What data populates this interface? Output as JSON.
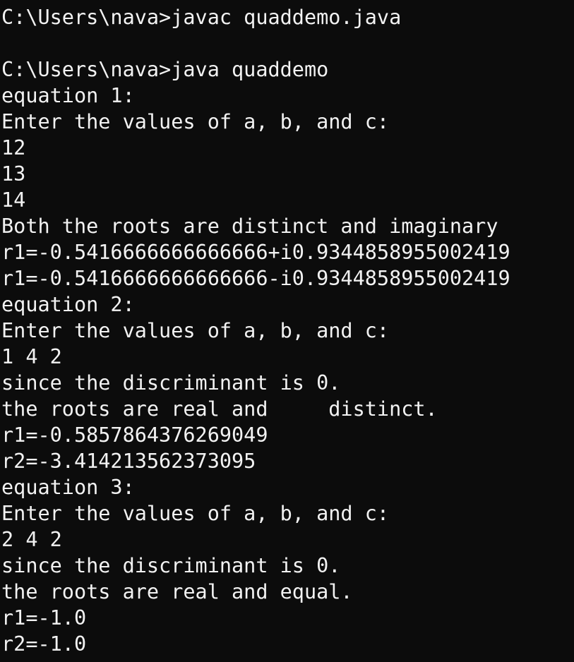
{
  "terminal": {
    "lines": [
      "C:\\Users\\nava>javac quaddemo.java",
      "",
      "C:\\Users\\nava>java quaddemo",
      "equation 1:",
      "Enter the values of a, b, and c:",
      "12",
      "13",
      "14",
      "Both the roots are distinct and imaginary",
      "r1=-0.5416666666666666+i0.9344858955002419",
      "r1=-0.5416666666666666-i0.9344858955002419",
      "equation 2:",
      "Enter the values of a, b, and c:",
      "1 4 2",
      "since the discriminant is 0.",
      "the roots are real and     distinct.",
      "r1=-0.5857864376269049",
      "r2=-3.414213562373095",
      "equation 3:",
      "Enter the values of a, b, and c:",
      "2 4 2",
      "since the discriminant is 0.",
      "the roots are real and equal.",
      "r1=-1.0",
      "r2=-1.0"
    ]
  },
  "colors": {
    "background": "#0c0c0c",
    "foreground": "#f2f2f2"
  }
}
